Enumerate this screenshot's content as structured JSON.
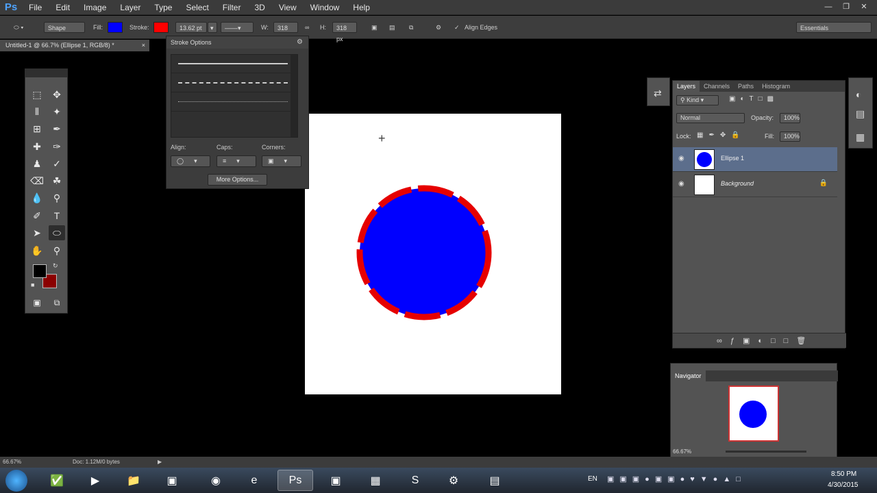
{
  "app": {
    "logo": "Ps"
  },
  "menu": [
    "File",
    "Edit",
    "Image",
    "Layer",
    "Type",
    "Select",
    "Filter",
    "3D",
    "View",
    "Window",
    "Help"
  ],
  "options_bar": {
    "mode": "Shape",
    "fill_label": "Fill:",
    "stroke_label": "Stroke:",
    "stroke_width": "13.62 pt",
    "w_label": "W:",
    "w_value": "318 px",
    "h_label": "H:",
    "h_value": "318 px",
    "align_edges": "Align Edges",
    "workspace": "Essentials",
    "fill_color": "#0000ff",
    "stroke_color": "#ff0000"
  },
  "document_tab": "Untitled-1 @ 66.7% (Ellipse 1, RGB/8) *",
  "stroke_options": {
    "title": "Stroke Options",
    "align_label": "Align:",
    "caps_label": "Caps:",
    "corners_label": "Corners:",
    "more_options": "More Options..."
  },
  "layers_panel": {
    "tabs": [
      "Layers",
      "Channels",
      "Paths",
      "Histogram"
    ],
    "kind": "Kind",
    "blend_mode": "Normal",
    "opacity_label": "Opacity:",
    "opacity": "100%",
    "lock_label": "Lock:",
    "fill_label": "Fill:",
    "fill": "100%",
    "layers": [
      {
        "name": "Ellipse 1",
        "selected": true
      },
      {
        "name": "Background",
        "selected": false
      }
    ]
  },
  "navigator": {
    "tab": "Navigator",
    "zoom": "66.67%"
  },
  "status_bar": {
    "zoom": "66.67%",
    "doc": "Doc: 1.12M/0 bytes"
  },
  "taskbar": {
    "lang": "EN",
    "time": "8:50 PM",
    "date": "4/30/2015"
  },
  "colors": {
    "foreground": "#000000",
    "background": "#8b0000",
    "ellipse_fill": "#0000ff",
    "ellipse_stroke": "#e60000"
  }
}
